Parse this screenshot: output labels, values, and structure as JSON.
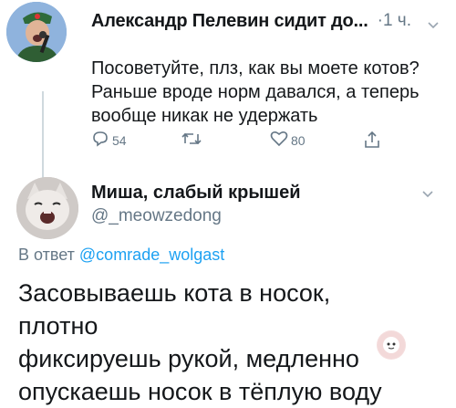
{
  "tweet": {
    "author_name": "Александр Пелевин сидит до...",
    "time": "·1 ч.",
    "text_lines": [
      "Посоветуйте, плз, как вы моете котов?",
      "Раньше вроде норм давался, а теперь",
      "вообще никак не удержать"
    ],
    "reply_count": "54",
    "like_count": "80",
    "icons": [
      "reply-icon",
      "retweet-icon",
      "like-icon",
      "share-icon",
      "chevron-down-icon"
    ]
  },
  "reply": {
    "author_name": "Миша, слабый крышей",
    "handle": "@_meowzedong",
    "reply_to_prefix": "В ответ",
    "reply_to_handle": "@comrade_wolgast",
    "text_lines": [
      "Засовываешь кота в носок, плотно",
      "фиксируешь рукой, медленно",
      "опускаешь носок в тёплую воду"
    ]
  },
  "colors": {
    "text": "#14171a",
    "secondary": "#657786",
    "link": "#1da1f2",
    "thread_line": "#cfd9de"
  }
}
